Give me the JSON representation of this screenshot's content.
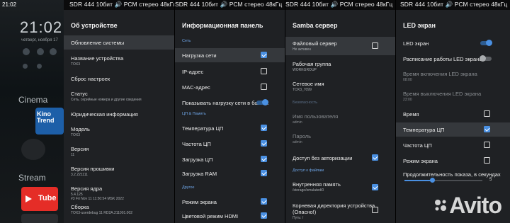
{
  "launcher": {
    "status_time": "21:02",
    "clock": "21:02",
    "date": "четверг, ноября 17",
    "section_cinema": "Cinema",
    "section_stream": "Stream",
    "kino_tile": "Kino\nTrend",
    "youtube_tile": "Tube"
  },
  "status_text": "SDR 444 10бит  🔊 РСМ стерео 48кГц",
  "panels": {
    "device": {
      "title": "Об устройстве",
      "items": [
        {
          "label": "Обновление системы",
          "sub": ""
        },
        {
          "label": "Название устройства",
          "sub": "TOX3"
        },
        {
          "label": "Сброс настроек",
          "sub": ""
        },
        {
          "label": "Статус",
          "sub": "Сеть, серийные номера и другие сведения"
        },
        {
          "label": "Юридическая информация",
          "sub": ""
        },
        {
          "label": "Модель",
          "sub": "TOX3"
        },
        {
          "label": "Версия",
          "sub": "11"
        },
        {
          "label": "Версия прошивки",
          "sub": "3.2.221111"
        },
        {
          "label": "Версия ядра",
          "sub": "5.4.125\n#3 Fri Nov 11 11:50:54 MSK 2022"
        },
        {
          "label": "Сборка",
          "sub": "TOX3-userdebug 11 RD2A.211001.002"
        }
      ]
    },
    "info": {
      "title": "Информационная панель",
      "section_net": "Сеть",
      "section_cpu": "ЦП & Память",
      "section_other": "Другое",
      "items": [
        {
          "label": "Нагрузка сети",
          "checked": true
        },
        {
          "label": "IP-адрес",
          "checked": false
        },
        {
          "label": "MAC-адрес",
          "checked": false
        },
        {
          "label": "Показывать нагрузку сети в байтах",
          "toggle": true
        },
        {
          "label": "Температура ЦП",
          "checked": true
        },
        {
          "label": "Частота ЦП",
          "checked": true
        },
        {
          "label": "Загрузка ЦП",
          "checked": true
        },
        {
          "label": "Загрузка RAM",
          "checked": true
        },
        {
          "label": "Режим экрана",
          "checked": true
        },
        {
          "label": "Цветовой режим HDMI",
          "checked": true
        }
      ]
    },
    "samba": {
      "title": "Samba сервер",
      "section_access": "Безопасность",
      "section_files": "Доступ к файлам",
      "items": [
        {
          "label": "Файловый сервер",
          "sub": "Не активен",
          "checked": false
        },
        {
          "label": "Рабочая группа",
          "sub": "WORKGROUP"
        },
        {
          "label": "Сетевое имя",
          "sub": "TOX3_7099"
        },
        {
          "label": "Имя пользователя",
          "sub": "admin"
        },
        {
          "label": "Пароль",
          "sub": "admin"
        },
        {
          "label": "Доступ без авторизации",
          "checked": true
        },
        {
          "label": "Внутренняя память",
          "sub": "/storage/emulated/0",
          "checked": true
        },
        {
          "label": "Корневая директория устройства\n(Опасно!)",
          "sub": "Путь: /",
          "checked": false
        }
      ]
    },
    "led": {
      "title": "LED экран",
      "items": [
        {
          "label": "LED экран",
          "toggle": true
        },
        {
          "label": "Расписание работы LED экрана",
          "toggle": false
        },
        {
          "label": "Время включения LED экрана",
          "sub": "08:00"
        },
        {
          "label": "Время выключения LED экрана",
          "sub": "23:00"
        },
        {
          "label": "Время",
          "checked": false
        },
        {
          "label": "Температура ЦП",
          "checked": true
        },
        {
          "label": "Частота ЦП",
          "checked": false
        },
        {
          "label": "Режим экрана",
          "checked": false
        },
        {
          "label": "Продолжительность показа, в секундах",
          "value": "5"
        }
      ],
      "slider_fraction": 0.35
    }
  },
  "watermark": "Avito",
  "colors": {
    "accent": "#4a90e2",
    "panel_bg": "#1f2124",
    "selected": "#35383c",
    "section": "#6fa6e8"
  }
}
